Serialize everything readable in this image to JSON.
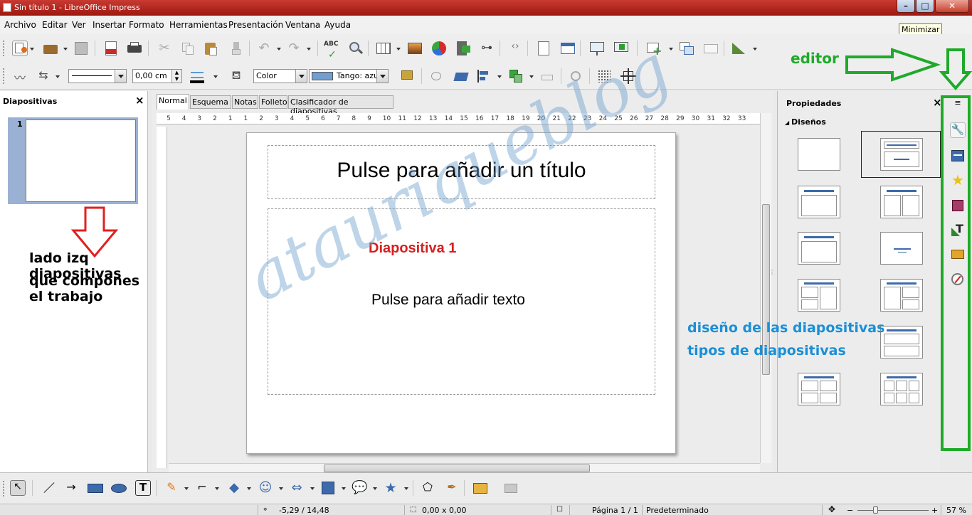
{
  "window": {
    "title": "Sin título 1 - LibreOffice Impress",
    "tooltip": "Minimizar"
  },
  "menu": [
    "Archivo",
    "Editar",
    "Ver",
    "Insertar",
    "Formato",
    "Herramientas",
    "Presentación",
    "Ventana",
    "Ayuda"
  ],
  "formatting": {
    "line_width": "0,00 cm",
    "area_style": "Color",
    "area_color": "Tango: azu"
  },
  "slides_panel": {
    "title": "Diapositivas",
    "slide_number": "1"
  },
  "tabs": [
    "Normal",
    "Esquema",
    "Notas",
    "Folleto",
    "Clasificador de diapositivas"
  ],
  "ruler_ticks": [
    "5",
    "4",
    "3",
    "2",
    "1",
    "1",
    "2",
    "3",
    "4",
    "5",
    "6",
    "7",
    "8",
    "9",
    "10",
    "11",
    "12",
    "13",
    "14",
    "15",
    "16",
    "17",
    "18",
    "19",
    "20",
    "21",
    "22",
    "23",
    "24",
    "25",
    "26",
    "27",
    "28",
    "29",
    "30",
    "31",
    "32",
    "33"
  ],
  "slide": {
    "title_placeholder": "Pulse para añadir un título",
    "red_text": "Diapositiva 1",
    "body_placeholder": "Pulse para añadir texto"
  },
  "properties": {
    "title": "Propiedades",
    "section": "Diseños"
  },
  "annotations": {
    "editor": "editor",
    "left_line1": "lado izq diapositivas",
    "left_line2": "que compones el trabajo",
    "right_line1": "diseño de las diapositivas",
    "right_line2": "tipos de diapositivas",
    "watermark": "atauriqueblog"
  },
  "status": {
    "position": "-5,29 / 14,48",
    "size": "0,00 x 0,00",
    "page": "Página 1 / 1",
    "master": "Predeterminado",
    "zoom": "57 %"
  },
  "colors": {
    "accent_blue": "#3d6aaa",
    "annotation_green": "#1faa2a",
    "annotation_red": "#e02020",
    "annotation_blue": "#1a8fd6"
  }
}
